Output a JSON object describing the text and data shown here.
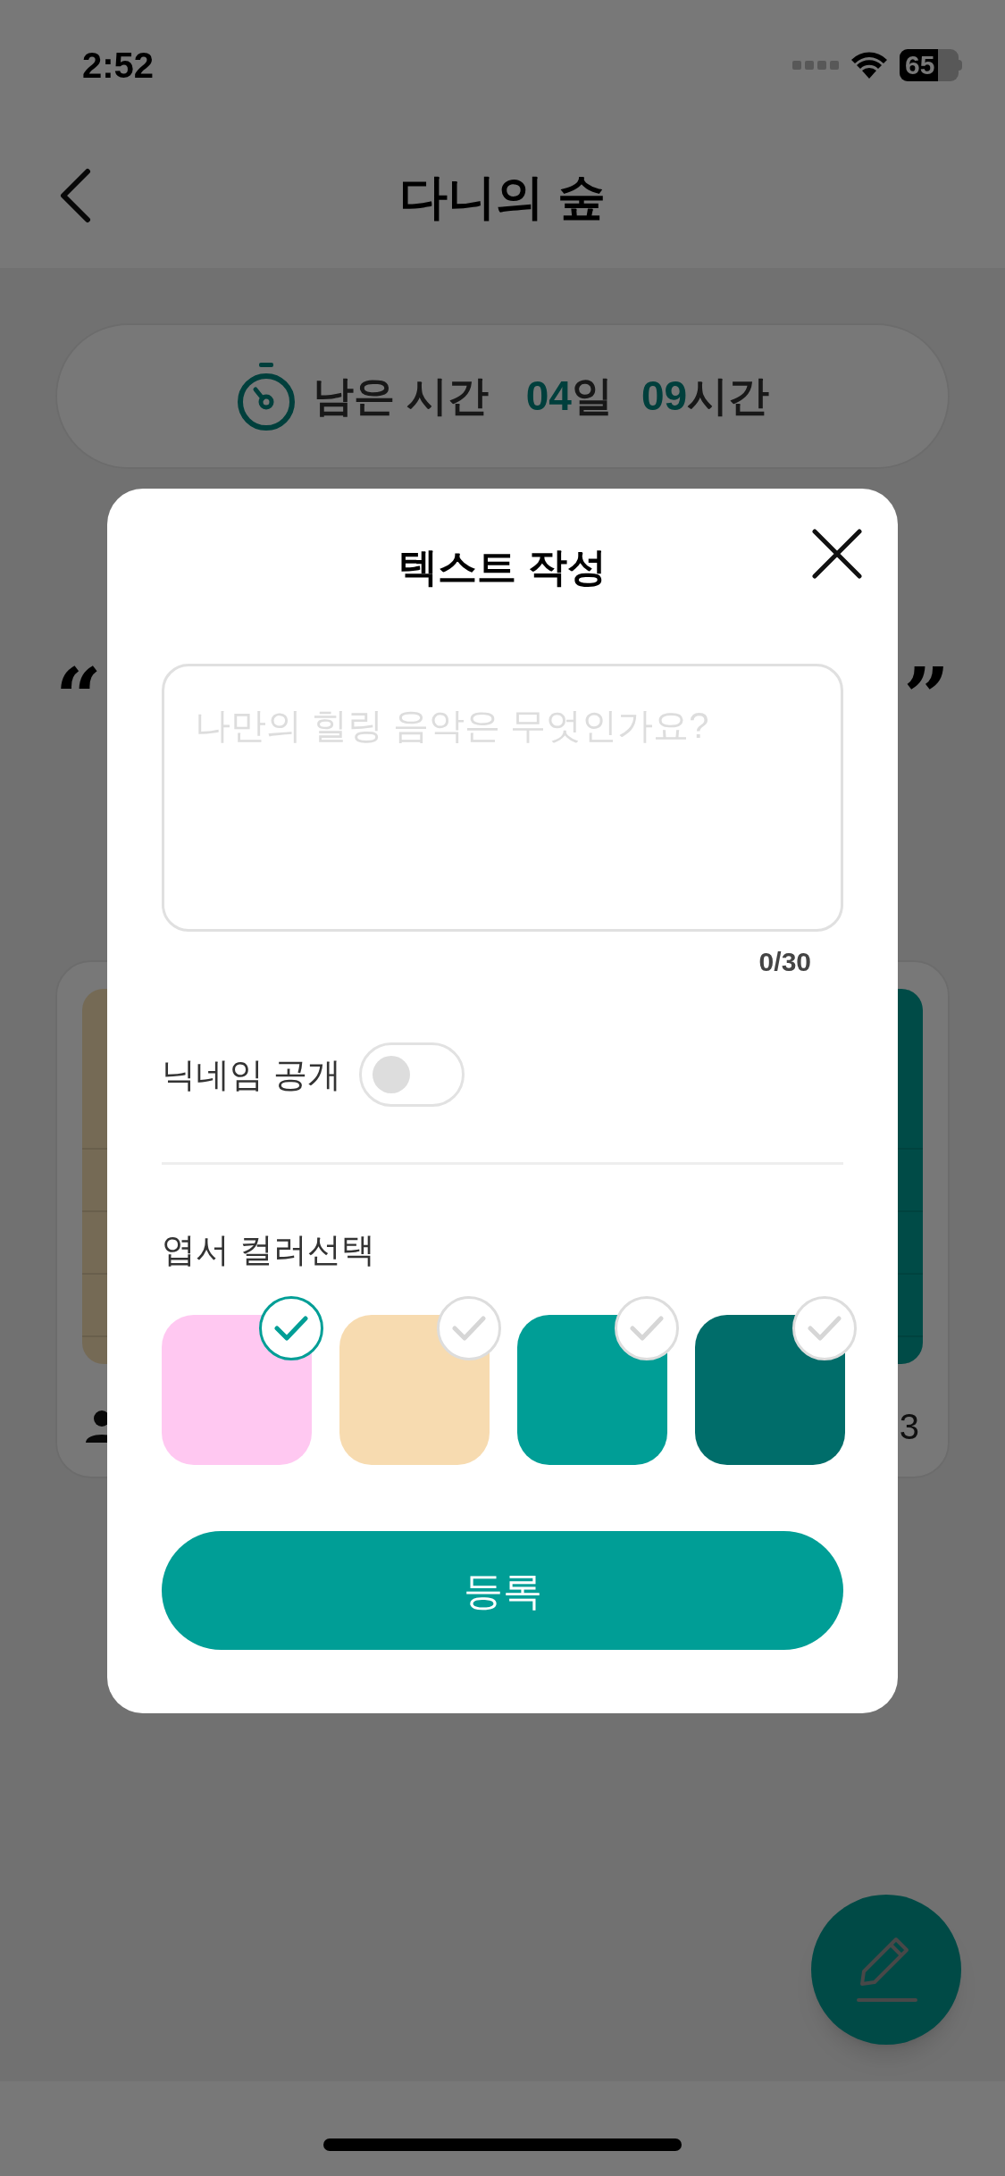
{
  "status_bar": {
    "time": "2:52",
    "battery": "65"
  },
  "header": {
    "title": "다니의 숲"
  },
  "timer": {
    "label": "남은 시간",
    "days": "04",
    "days_unit": "일",
    "hours": "09",
    "hours_unit": "시간"
  },
  "quotes": {
    "open": "“",
    "close": "”"
  },
  "postcards": [
    {
      "color": "#756a55"
    },
    {
      "color": "#004b47"
    }
  ],
  "card_footer": {
    "right_text": "3"
  },
  "modal": {
    "title": "텍스트 작성",
    "text_field": {
      "placeholder": "나만의 힐링 음악은 무엇인가요?"
    },
    "counter": "0/30",
    "nickname": {
      "label": "닉네임 공개",
      "on": false
    },
    "color_label": "엽서 컬러선택",
    "swatches": [
      {
        "color": "#ffc8f1",
        "selected": true
      },
      {
        "color": "#f7dbb0",
        "selected": false
      },
      {
        "color": "#009e96",
        "selected": false
      },
      {
        "color": "#006d6a",
        "selected": false
      }
    ],
    "submit": "등록"
  }
}
